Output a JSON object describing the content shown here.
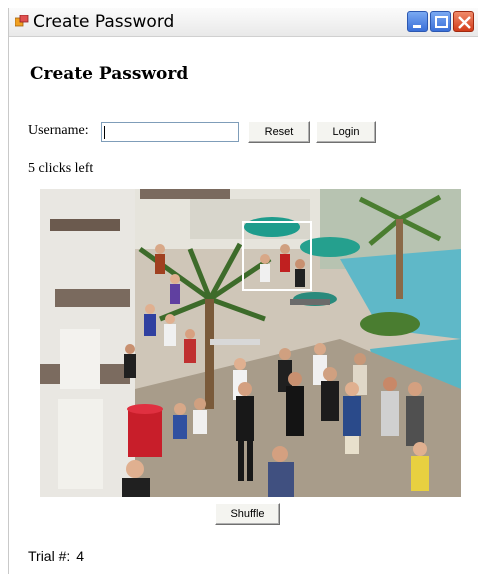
{
  "window": {
    "title": "Create Password"
  },
  "form": {
    "heading": "Create Password",
    "username_label": "Username:",
    "username_value": "",
    "reset_label": "Reset",
    "login_label": "Login",
    "clicks_text": "5 clicks left"
  },
  "photo": {
    "description_icon": "crowd-plaza-photo"
  },
  "footer": {
    "shuffle_label": "Shuffle",
    "trial_label": "Trial #:",
    "trial_value": "4"
  },
  "colors": {
    "title_bar": "#efefef",
    "close_button": "#d23c1a",
    "min_max_button": "#3a6fd8",
    "selection_box": "#ffffff"
  }
}
